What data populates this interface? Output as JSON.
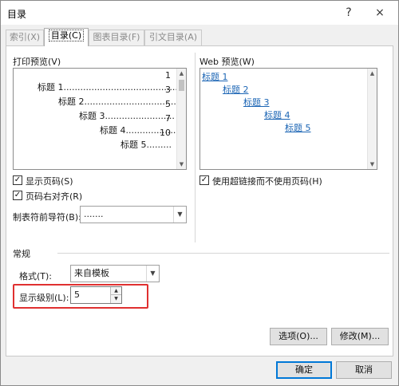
{
  "window": {
    "title": "目录",
    "help_label": "?",
    "close_label": "×"
  },
  "tabs": [
    {
      "label": "索引(X)"
    },
    {
      "label": "目录(C)"
    },
    {
      "label": "图表目录(F)"
    },
    {
      "label": "引文目录(A)"
    }
  ],
  "print_preview": {
    "label": "打印预览(V)",
    "entries": [
      {
        "text": "标题 1.........................................",
        "page": "1"
      },
      {
        "text": "标题 2.................................",
        "page": "3"
      },
      {
        "text": "标题 3.........................",
        "page": "5"
      },
      {
        "text": "标题 4..................",
        "page": "7"
      },
      {
        "text": "标题 5.........",
        "page": "10"
      }
    ]
  },
  "web_preview": {
    "label": "Web 预览(W)",
    "entries": [
      "标题 1",
      "标题 2",
      "标题 3",
      "标题 4",
      "标题 5"
    ]
  },
  "options": {
    "show_page_numbers": "显示页码(S)",
    "right_align_page_numbers": "页码右对齐(R)",
    "tab_leader_label": "制表符前导符(B):",
    "tab_leader_value": ".......",
    "use_hyperlinks": "使用超链接而不使用页码(H)"
  },
  "general": {
    "section_label": "常规",
    "format_label": "格式(T):",
    "format_value": "来自模板",
    "levels_label": "显示级别(L):",
    "levels_value": "5"
  },
  "buttons": {
    "options": "选项(O)...",
    "modify": "修改(M)...",
    "ok": "确定",
    "cancel": "取消"
  },
  "colors": {
    "highlight_box": "#e03030",
    "hyperlink": "#1a64b4",
    "default_button_border": "#0078d7"
  },
  "icons": {
    "checkbox": "check-icon",
    "dropdown": "chevron-down-icon",
    "spinner": "spin-arrows-icon"
  }
}
